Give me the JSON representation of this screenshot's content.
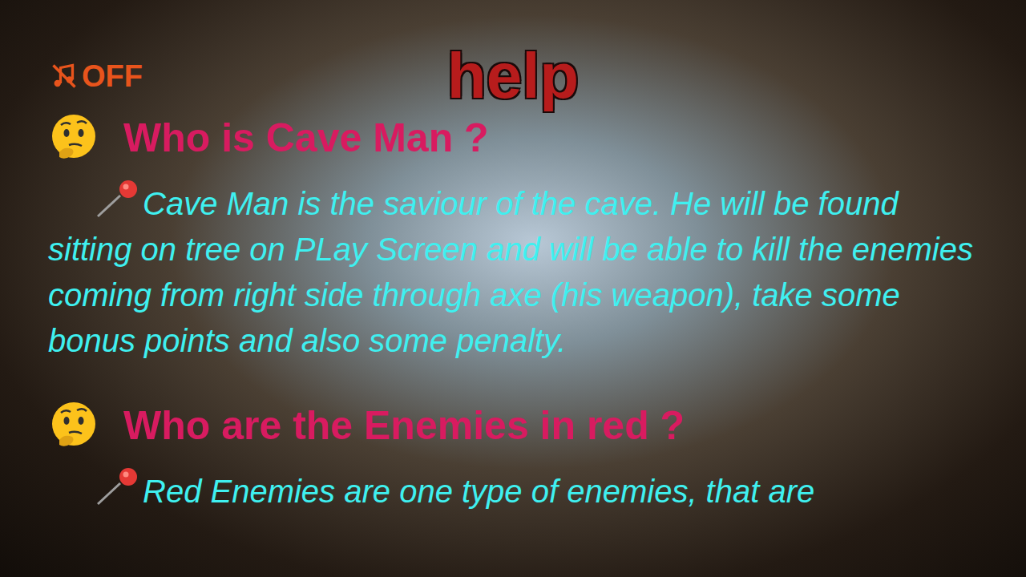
{
  "sound": {
    "label": "OFF",
    "on": false
  },
  "title": "help",
  "sections": [
    {
      "question": "Who is Cave Man ?",
      "answer": "Cave Man is the saviour of the cave. He will be found sitting on tree on PLay Screen and will be able to kill the enemies coming from right side through axe (his weapon), take some bonus points and also some penalty."
    },
    {
      "question": "Who are the Enemies in red ?",
      "answer": "Red Enemies are one type of enemies, that are"
    }
  ]
}
